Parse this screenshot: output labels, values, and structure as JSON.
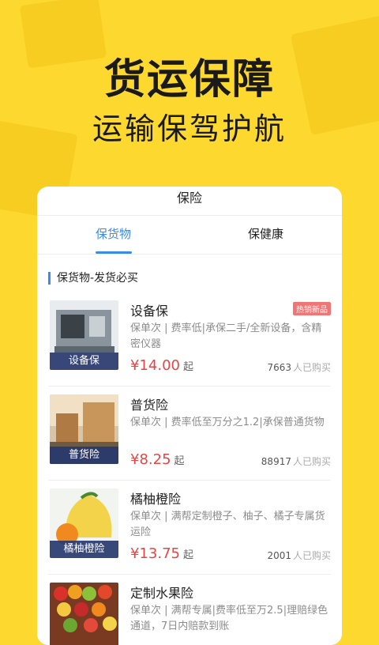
{
  "hero": {
    "title": "货运保障",
    "subtitle": "运输保驾护航"
  },
  "card": {
    "title": "保险",
    "tabs": [
      {
        "label": "保货物"
      },
      {
        "label": "保健康"
      }
    ],
    "section_title": "保货物-发货必买",
    "items": [
      {
        "name": "设备保",
        "thumb_label": "设备保",
        "badge": "热销新品",
        "desc": "保单次 | 费率低|承保二手/全新设备，含精密仪器",
        "price": "¥14.00",
        "unit": "起",
        "count": "7663",
        "count_suffix": "人已购买"
      },
      {
        "name": "普货险",
        "thumb_label": "普货险",
        "badge": "",
        "desc": "保单次 | 费率低至万分之1.2|承保普通货物",
        "price": "¥8.25",
        "unit": "起",
        "count": "88917",
        "count_suffix": "人已购买"
      },
      {
        "name": "橘柚橙险",
        "thumb_label": "橘柚橙险",
        "badge": "",
        "desc": "保单次 | 满帮定制橙子、柚子、橘子专属货运险",
        "price": "¥13.75",
        "unit": "起",
        "count": "2001",
        "count_suffix": "人已购买"
      },
      {
        "name": "定制水果险",
        "thumb_label": "",
        "badge": "",
        "desc": "保单次 | 满帮专属|费率低至万2.5|理赔绿色通道，7日内赔款到账",
        "price": "",
        "unit": "",
        "count": "",
        "count_suffix": ""
      }
    ]
  },
  "colors": {
    "background": "#FDD82E",
    "accent": "#3C8CE7",
    "price": "#E64545",
    "badge": "#F07575"
  }
}
